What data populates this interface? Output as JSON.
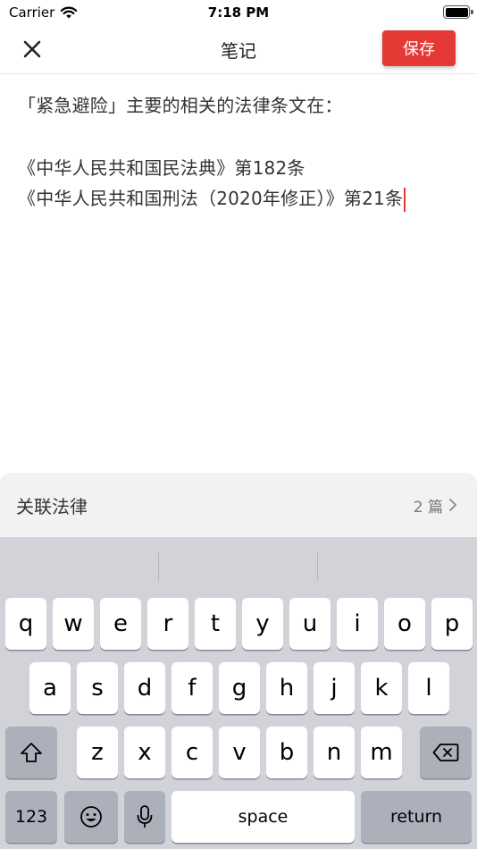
{
  "status_bar": {
    "carrier": "Carrier",
    "time": "7:18 PM",
    "wifi_icon": "wifi-icon",
    "battery_icon": "battery-icon"
  },
  "nav": {
    "title": "笔记",
    "save_label": "保存",
    "close_icon": "close-icon",
    "accent_color": "#e53935"
  },
  "note": {
    "lines": [
      "「紧急避险」主要的相关的法律条文在：",
      "",
      "《中华人民共和国民法典》第182条",
      "《中华人民共和国刑法（2020年修正）》第21条"
    ]
  },
  "related_laws": {
    "label": "关联法律",
    "count": "2 篇",
    "chevron_icon": "chevron-right-icon"
  },
  "keyboard": {
    "row1": [
      "q",
      "w",
      "e",
      "r",
      "t",
      "y",
      "u",
      "i",
      "o",
      "p"
    ],
    "row2": [
      "a",
      "s",
      "d",
      "f",
      "g",
      "h",
      "j",
      "k",
      "l"
    ],
    "row3": [
      "z",
      "x",
      "c",
      "v",
      "b",
      "n",
      "m"
    ],
    "numbers_label": "123",
    "space_label": "space",
    "return_label": "return",
    "shift_icon": "shift-icon",
    "delete_icon": "delete-icon",
    "emoji_icon": "emoji-icon",
    "mic_icon": "microphone-icon"
  }
}
